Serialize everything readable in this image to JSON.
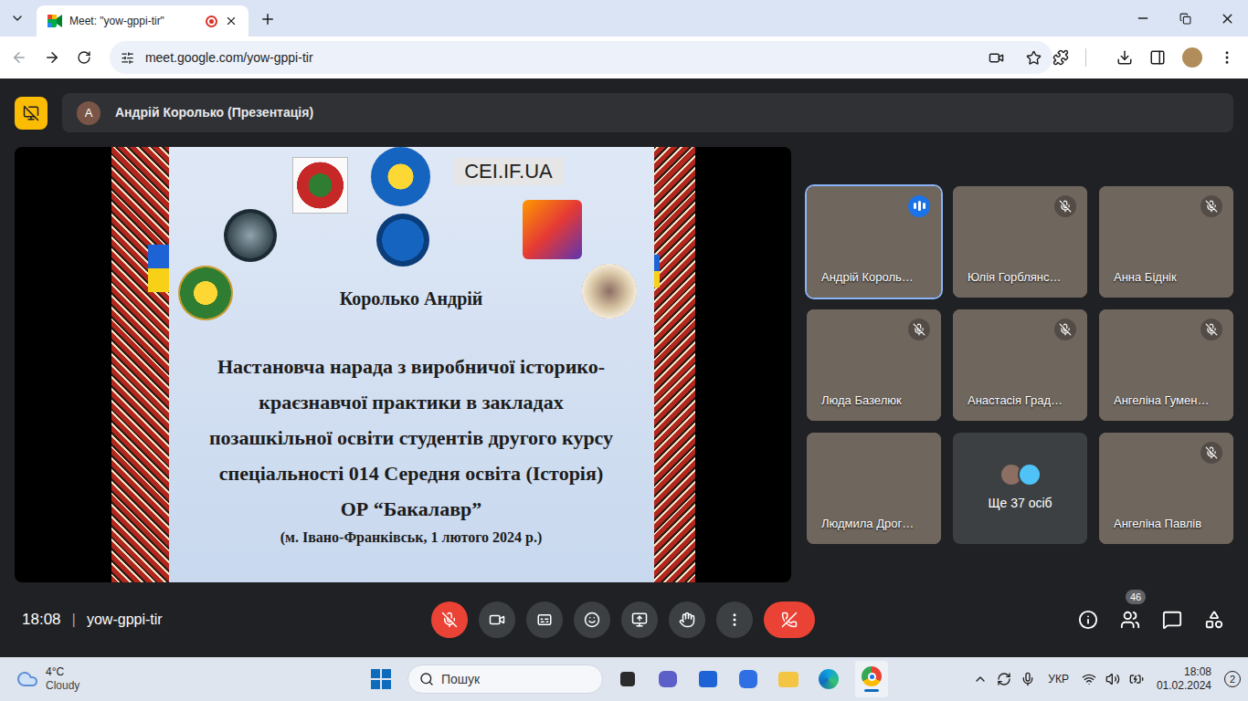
{
  "browser": {
    "tab_title": "Meet: \"yow-gppi-tir\"",
    "recording": true,
    "url": "meet.google.com/yow-gppi-tir"
  },
  "presenter": {
    "initial": "А",
    "label": "Андрій Королько (Презентація)"
  },
  "slide": {
    "logo_text": "CEI.IF.UA",
    "author": "Королько Андрій",
    "title_lines": [
      "Настановча нарада з виробничої історико-",
      "краєзнавчої практики в закладах",
      "позашкільної освіти студентів другого курсу",
      "спеціальності 014 Середня освіта (Історія)",
      "ОР “Бакалавр”"
    ],
    "place_date": "(м. Івано-Франківськ, 1 лютого 2024 р.)"
  },
  "participants": [
    {
      "name": "Андрій Король…",
      "kind": "video",
      "muted": false,
      "speaking": true
    },
    {
      "name": "Юлія Горблянс…",
      "kind": "video",
      "muted": true,
      "speaking": false
    },
    {
      "name": "Анна Біднік",
      "kind": "video",
      "muted": true,
      "speaking": false
    },
    {
      "name": "Люда Базелюк",
      "kind": "video",
      "muted": true,
      "speaking": false
    },
    {
      "name": "Анастасія Град…",
      "kind": "video",
      "muted": true,
      "speaking": false
    },
    {
      "name": "Ангеліна Гумен…",
      "kind": "video",
      "muted": true,
      "speaking": false
    },
    {
      "name": "Людмила Дрог…",
      "kind": "video",
      "muted": false,
      "speaking": false
    },
    {
      "name": "Ще 37 осіб",
      "kind": "more"
    },
    {
      "name": "Ангеліна Павлів",
      "kind": "video",
      "muted": true,
      "speaking": false
    }
  ],
  "meeting": {
    "time": "18:08",
    "separator": "|",
    "code": "yow-gppi-tir",
    "mic_muted": true,
    "participant_count": "46"
  },
  "taskbar": {
    "temperature": "4°C",
    "weather": "Cloudy",
    "search_placeholder": "Пошук",
    "language": "УКР",
    "time": "18:08",
    "date": "01.02.2024",
    "notifications": "2"
  }
}
